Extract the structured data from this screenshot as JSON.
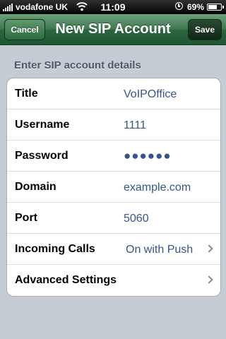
{
  "status_bar": {
    "carrier": "vodafone UK",
    "time": "11:09",
    "battery_text": "69%",
    "battery_level": 0.69
  },
  "nav": {
    "title": "New SIP Account",
    "cancel_label": "Cancel",
    "save_label": "Save"
  },
  "section": {
    "header": "Enter SIP account details"
  },
  "form": {
    "rows": [
      {
        "label": "Title",
        "value": "VoIPOffice"
      },
      {
        "label": "Username",
        "value": "1111"
      },
      {
        "label": "Password",
        "value": "●●●●●●"
      },
      {
        "label": "Domain",
        "value": "example.com"
      },
      {
        "label": "Port",
        "value": "5060"
      },
      {
        "label": "Incoming Calls",
        "value": "On with Push"
      },
      {
        "label": "Advanced Settings",
        "value": ""
      }
    ]
  },
  "colors": {
    "nav_green": "#2c6640",
    "value_blue": "#385487",
    "background": "#c5ccd3"
  }
}
